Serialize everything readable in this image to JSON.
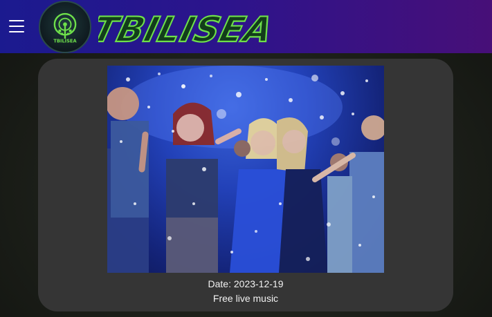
{
  "header": {
    "brand_text": "TBILISEA",
    "logo_text": "TBILISEA",
    "menu_icon": "hamburger-menu-icon",
    "gradient_start": "#1b1a8f",
    "gradient_end": "#470f78",
    "brand_color": "#6ee04a"
  },
  "event": {
    "date_line": "Date: 2023-12-19",
    "description": "Free live music",
    "image_subject": "party-crowd-dancing-photo"
  }
}
